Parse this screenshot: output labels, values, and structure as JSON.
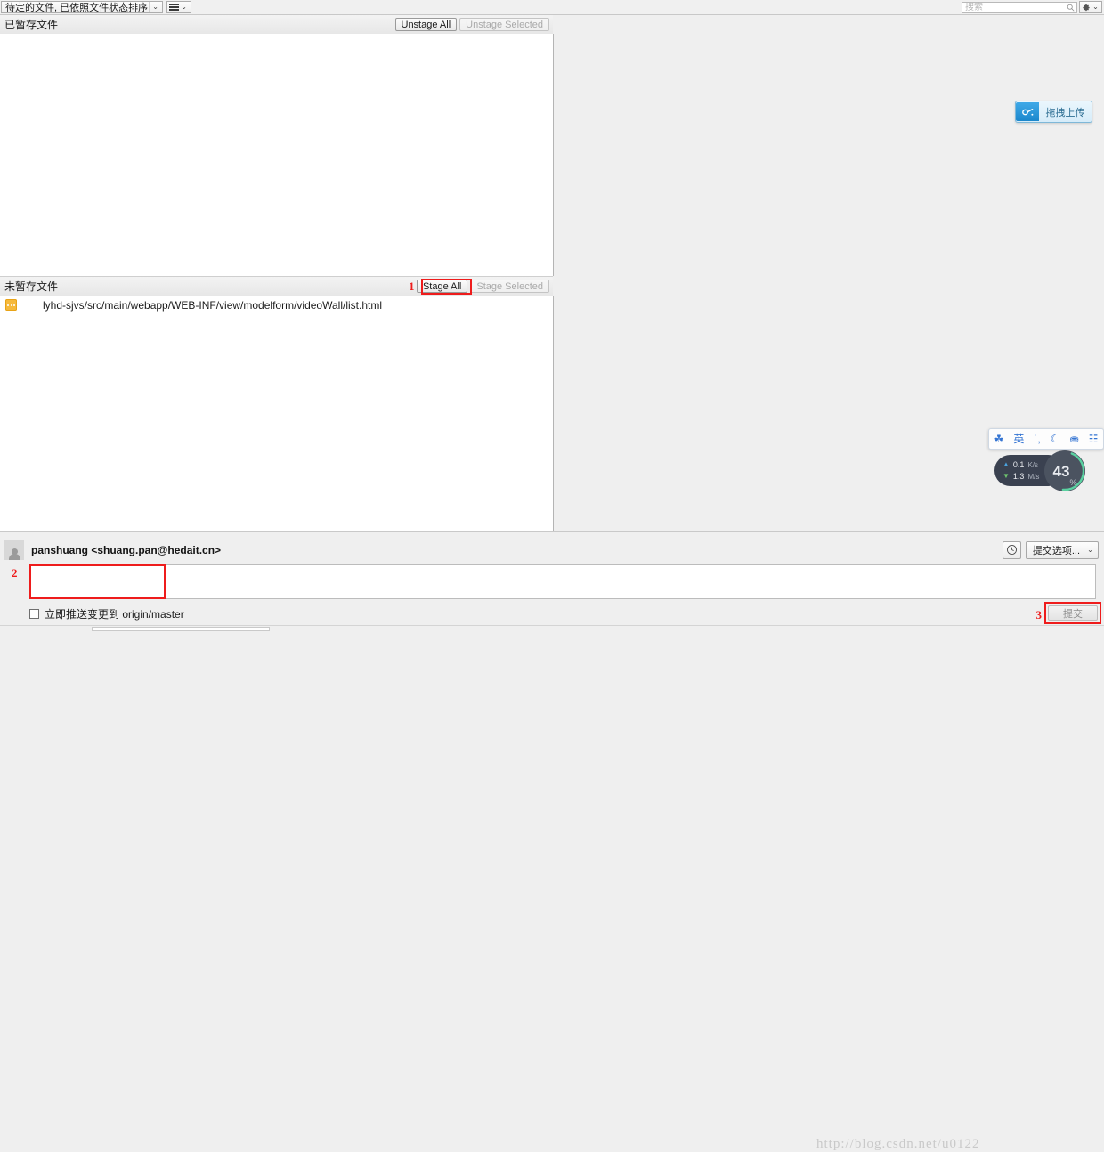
{
  "toolbar": {
    "sort_combo_value": "待定的文件, 已依照文件状态排序",
    "view_icon": "list-view-icon",
    "search_placeholder": "搜索",
    "search_value": "",
    "search_icon": "search-icon",
    "gear_icon": "gear-icon",
    "caret": "⌄"
  },
  "staged": {
    "title": "已暂存文件",
    "unstage_all_label": "Unstage All",
    "unstage_selected_label": "Unstage Selected",
    "files": []
  },
  "unstaged": {
    "title": "未暂存文件",
    "stage_all_label": "Stage All",
    "stage_selected_label": "Stage Selected",
    "files": [
      {
        "status_icon": "modified-file-icon",
        "path": "lyhd-sjvs/src/main/webapp/WEB-INF/view/modelform/videoWall/list.html"
      }
    ]
  },
  "commit": {
    "author": "panshuang <shuang.pan@hedait.cn>",
    "avatar_icon": "user-avatar-icon",
    "message_value": "",
    "message_placeholder": "",
    "history_icon": "clock-icon",
    "commit_options_label": "提交选项...",
    "push_checkbox_label": "立即推送变更到 origin/master",
    "push_checked": false,
    "commit_button_label": "提交"
  },
  "annotations": [
    {
      "number": "1",
      "target": "stage-all-button"
    },
    {
      "number": "2",
      "target": "commit-message-input"
    },
    {
      "number": "3",
      "target": "commit-button"
    }
  ],
  "watermark": {
    "text": "http://blog.csdn.net/u0122"
  },
  "upload_widget": {
    "label": "拖拽上传",
    "icon": "link-chain-icon"
  },
  "ime_toolbar": {
    "items": [
      {
        "name": "baidu-paw-logo-icon",
        "glyph": "☘"
      },
      {
        "name": "language-mode-label",
        "glyph": "英"
      },
      {
        "name": "punctuation-icon",
        "glyph": "˙,"
      },
      {
        "name": "moon-icon",
        "glyph": "☾"
      },
      {
        "name": "user-icon",
        "glyph": "⛂"
      },
      {
        "name": "toolbox-grid-icon",
        "glyph": "☷"
      }
    ]
  },
  "network_monitor": {
    "upload_speed": "0.1",
    "upload_unit": "K/s",
    "download_speed": "1.3",
    "download_unit": "M/s",
    "percent": "43",
    "percent_symbol": "%"
  }
}
